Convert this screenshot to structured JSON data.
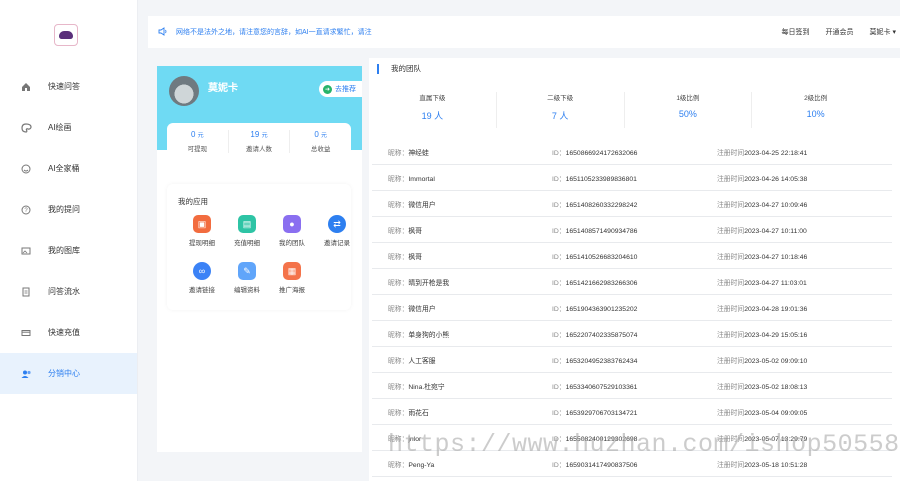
{
  "sidebar": {
    "items": [
      {
        "label": "快速问答",
        "icon": "home-icon"
      },
      {
        "label": "AI绘画",
        "icon": "palette-icon"
      },
      {
        "label": "AI全家桶",
        "icon": "smile-icon"
      },
      {
        "label": "我的提问",
        "icon": "question-icon"
      },
      {
        "label": "我的图库",
        "icon": "image-icon"
      },
      {
        "label": "问答流水",
        "icon": "document-icon"
      },
      {
        "label": "快速充值",
        "icon": "card-icon"
      },
      {
        "label": "分销中心",
        "icon": "users-icon"
      }
    ],
    "active_index": 7
  },
  "topbar": {
    "notice": "网络不是法外之地，请注意您的言辞，如AI一直请求繁忙，请注",
    "actions": {
      "checkin": "每日签到",
      "membership": "开通会员",
      "user": "莫妮卡"
    }
  },
  "profile": {
    "name": "莫妮卡",
    "promo_label": "去推荐",
    "stats": [
      {
        "value": "0",
        "unit": "元",
        "label": "可提现"
      },
      {
        "value": "19",
        "unit": "元",
        "label": "邀请人数"
      },
      {
        "value": "0",
        "unit": "元",
        "label": "总收益"
      }
    ]
  },
  "tools": {
    "title": "我的应用",
    "items": [
      {
        "label": "提现明细",
        "icon": "withdraw-icon",
        "color": "#f26c3f"
      },
      {
        "label": "充值明细",
        "icon": "recharge-icon",
        "color": "#2ec4a5"
      },
      {
        "label": "我的团队",
        "icon": "team-icon",
        "color": "#8a6ff0"
      },
      {
        "label": "邀请记录",
        "icon": "swap-icon",
        "color": "#2d7ff0"
      },
      {
        "label": "邀请链接",
        "icon": "link-icon",
        "color": "#3b82f6"
      },
      {
        "label": "编辑资料",
        "icon": "edit-profile-icon",
        "color": "#60a5fa"
      },
      {
        "label": "推广海报",
        "icon": "poster-icon",
        "color": "#f4734a"
      }
    ]
  },
  "team": {
    "title": "我的团队",
    "summary": [
      {
        "label": "直属下级",
        "value": "19 人"
      },
      {
        "label": "二级下级",
        "value": "7 人"
      },
      {
        "label": "1级比例",
        "value": "50%"
      },
      {
        "label": "2级比例",
        "value": "10%"
      }
    ],
    "nick_label": "昵称：",
    "id_label": "ID：",
    "time_label": "注册时间",
    "members": [
      {
        "nick": "神经蛙",
        "id": "1650866924172632066",
        "time": "2023-04-25 22:18:41"
      },
      {
        "nick": "Immortal",
        "id": "1651105233989836801",
        "time": "2023-04-26 14:05:38"
      },
      {
        "nick": "微信用户",
        "id": "1651408260332298242",
        "time": "2023-04-27 10:09:46"
      },
      {
        "nick": "枫哥",
        "id": "1651408571490934786",
        "time": "2023-04-27 10:11:00"
      },
      {
        "nick": "枫哥",
        "id": "1651410526683204610",
        "time": "2023-04-27 10:18:46"
      },
      {
        "nick": "晴到开枪是我",
        "id": "1651421662983266306",
        "time": "2023-04-27 11:03:01"
      },
      {
        "nick": "微信用户",
        "id": "1651904363901235202",
        "time": "2023-04-28 19:01:36"
      },
      {
        "nick": "单身狗的小熊",
        "id": "1652207402335875074",
        "time": "2023-04-29 15:05:16"
      },
      {
        "nick": "人工客服",
        "id": "1653204952383762434",
        "time": "2023-05-02 09:09:10"
      },
      {
        "nick": "Nina.杜宛宁",
        "id": "1653340607529103361",
        "time": "2023-05-02 18:08:13"
      },
      {
        "nick": "雨花石",
        "id": "1653929706703134721",
        "time": "2023-05-04 09:09:05"
      },
      {
        "nick": "jnlor",
        "id": "1655082400129302698",
        "time": "2023-05-07 13:29:79"
      },
      {
        "nick": "Peng-Ya",
        "id": "1659031417490837506",
        "time": "2023-05-18 10:51:28"
      }
    ]
  },
  "watermark": "https://www.huzhan.com/ishop50558"
}
